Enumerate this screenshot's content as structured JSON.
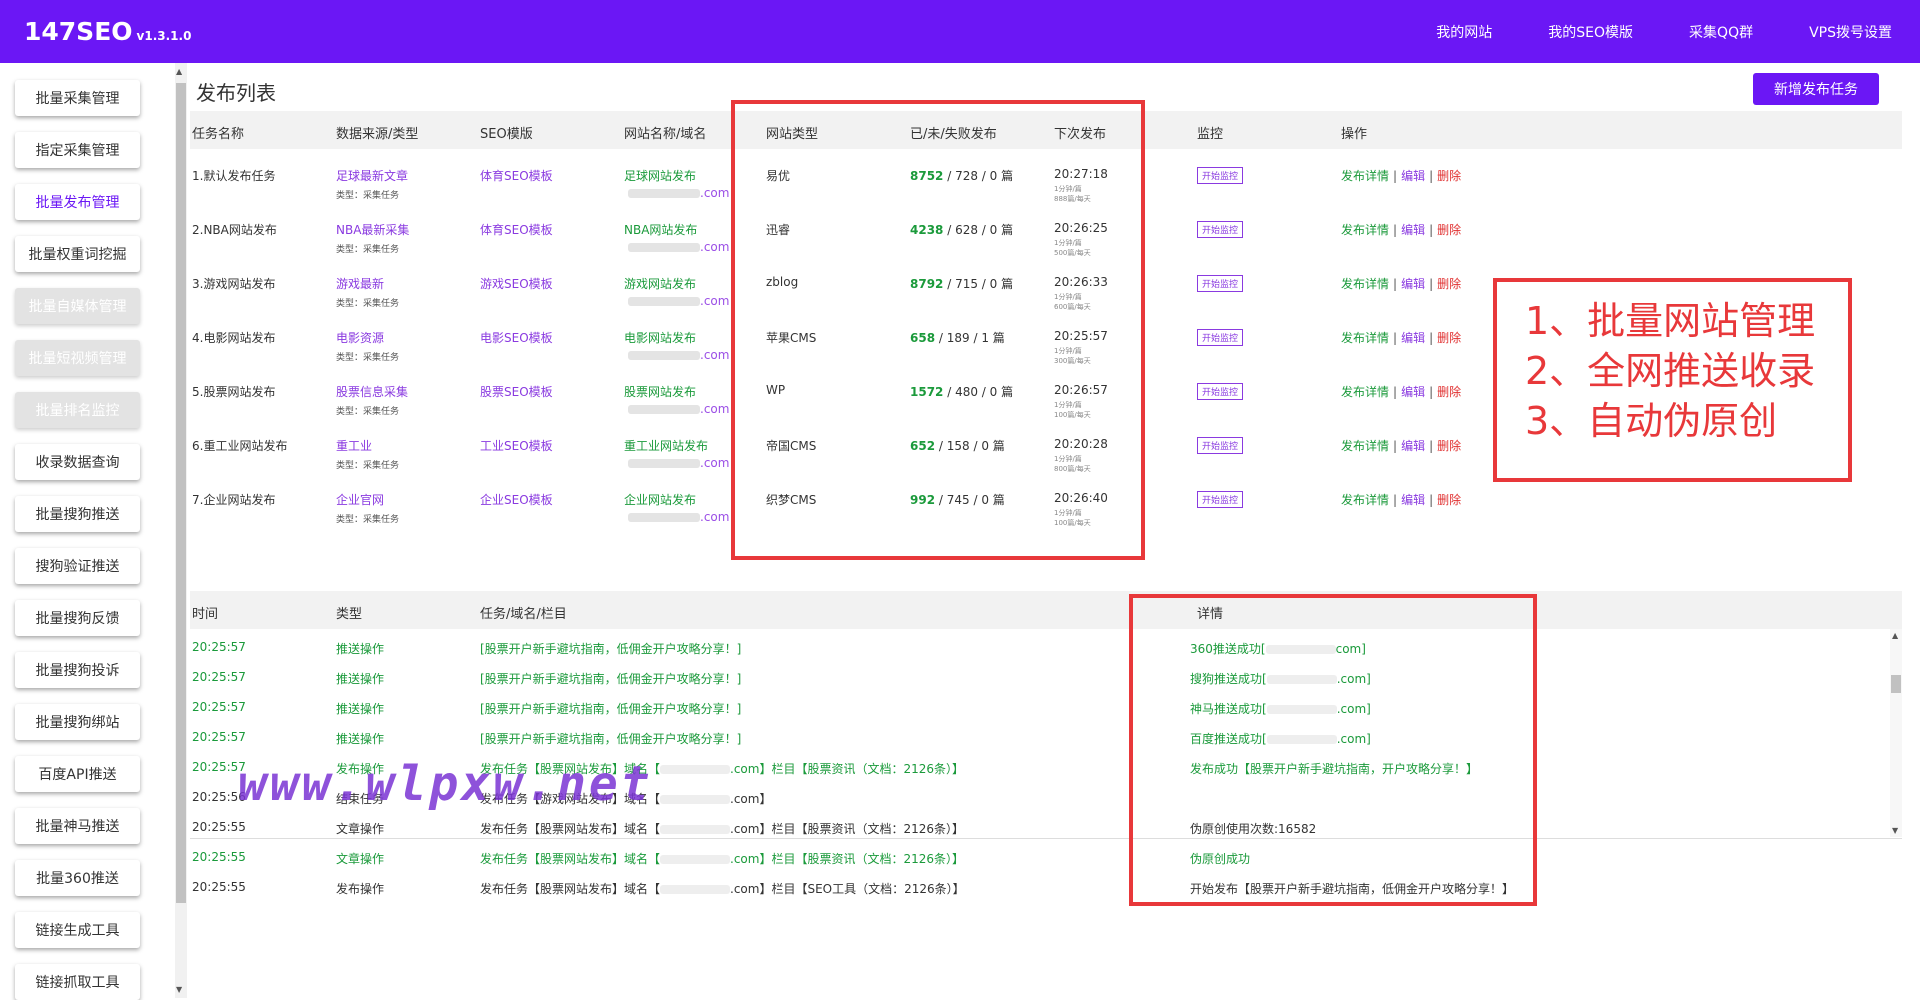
{
  "app": {
    "name": "147SEO",
    "version": "v1.3.1.0"
  },
  "nav": [
    "我的网站",
    "我的SEO模版",
    "采集QQ群",
    "VPS拨号设置"
  ],
  "sidebar": [
    {
      "label": "批量采集管理",
      "state": "normal"
    },
    {
      "label": "指定采集管理",
      "state": "normal"
    },
    {
      "label": "批量发布管理",
      "state": "active"
    },
    {
      "label": "批量权重词挖掘",
      "state": "normal"
    },
    {
      "label": "批量自媒体管理",
      "state": "disabled"
    },
    {
      "label": "批量短视频管理",
      "state": "disabled"
    },
    {
      "label": "批量排名监控",
      "state": "disabled"
    },
    {
      "label": "收录数据查询",
      "state": "normal"
    },
    {
      "label": "批量搜狗推送",
      "state": "normal"
    },
    {
      "label": "搜狗验证推送",
      "state": "normal"
    },
    {
      "label": "批量搜狗反馈",
      "state": "normal"
    },
    {
      "label": "批量搜狗投诉",
      "state": "normal"
    },
    {
      "label": "批量搜狗绑站",
      "state": "normal"
    },
    {
      "label": "百度API推送",
      "state": "normal"
    },
    {
      "label": "批量神马推送",
      "state": "normal"
    },
    {
      "label": "批量360推送",
      "state": "normal"
    },
    {
      "label": "链接生成工具",
      "state": "normal"
    },
    {
      "label": "链接抓取工具",
      "state": "normal"
    }
  ],
  "page": {
    "title": "发布列表",
    "add_button": "新增发布任务"
  },
  "table": {
    "headers": [
      "任务名称",
      "数据来源/类型",
      "SEO模版",
      "网站名称/域名",
      "网站类型",
      "已/未/失败发布",
      "下次发布",
      "监控",
      "操作"
    ],
    "source_type_label": "类型：采集任务",
    "domain_suffix": ".com",
    "monitor_label": "开始监控",
    "ops": {
      "detail": "发布详情",
      "edit": "编辑",
      "delete": "删除",
      "separator": "|"
    },
    "rows": [
      {
        "name": "1.默认发布任务",
        "source": "足球最新文章",
        "template": "体育SEO模板",
        "site": "足球网站发布",
        "site_type": "易优",
        "published": "8752",
        "unpublished": "728",
        "failed": "0 篇",
        "next_time": "20:27:18",
        "interval": "1分钟/篇",
        "daily": "888篇/每天"
      },
      {
        "name": "2.NBA网站发布",
        "source": "NBA最新采集",
        "template": "体育SEO模板",
        "site": "NBA网站发布",
        "site_type": "迅睿",
        "published": "4238",
        "unpublished": "628",
        "failed": "0 篇",
        "next_time": "20:26:25",
        "interval": "1分钟/篇",
        "daily": "500篇/每天"
      },
      {
        "name": "3.游戏网站发布",
        "source": "游戏最新",
        "template": "游戏SEO模板",
        "site": "游戏网站发布",
        "site_type": "zblog",
        "published": "8792",
        "unpublished": "715",
        "failed": "0 篇",
        "next_time": "20:26:33",
        "interval": "1分钟/篇",
        "daily": "600篇/每天"
      },
      {
        "name": "4.电影网站发布",
        "source": "电影资源",
        "template": "电影SEO模板",
        "site": "电影网站发布",
        "site_type": "苹果CMS",
        "published": "658",
        "unpublished": "189",
        "failed": "1 篇",
        "next_time": "20:25:57",
        "interval": "1分钟/篇",
        "daily": "300篇/每天"
      },
      {
        "name": "5.股票网站发布",
        "source": "股票信息采集",
        "template": "股票SEO模板",
        "site": "股票网站发布",
        "site_type": "WP",
        "published": "1572",
        "unpublished": "480",
        "failed": "0 篇",
        "next_time": "20:26:57",
        "interval": "1分钟/篇",
        "daily": "100篇/每天"
      },
      {
        "name": "6.重工业网站发布",
        "source": "重工业",
        "template": "工业SEO模板",
        "site": "重工业网站发布",
        "site_type": "帝国CMS",
        "published": "652",
        "unpublished": "158",
        "failed": "0 篇",
        "next_time": "20:20:28",
        "interval": "1分钟/篇",
        "daily": "800篇/每天"
      },
      {
        "name": "7.企业网站发布",
        "source": "企业官网",
        "template": "企业SEO模板",
        "site": "企业网站发布",
        "site_type": "织梦CMS",
        "published": "992",
        "unpublished": "745",
        "failed": "0 篇",
        "next_time": "20:26:40",
        "interval": "1分钟/篇",
        "daily": "100篇/每天"
      }
    ]
  },
  "log": {
    "headers": [
      "时间",
      "类型",
      "任务/域名/栏目",
      "详情"
    ],
    "rows": [
      {
        "time": "20:25:57",
        "type": "推送操作",
        "task": "[股票开户新手避坑指南，低佣金开户攻略分享！]",
        "detail": "360推送成功[",
        "detail_end": "com]",
        "color": "green"
      },
      {
        "time": "20:25:57",
        "type": "推送操作",
        "task": "[股票开户新手避坑指南，低佣金开户攻略分享！]",
        "detail": "搜狗推送成功[",
        "detail_end": ".com]",
        "color": "green"
      },
      {
        "time": "20:25:57",
        "type": "推送操作",
        "task": "[股票开户新手避坑指南，低佣金开户攻略分享！]",
        "detail": "神马推送成功[",
        "detail_end": ".com]",
        "color": "green"
      },
      {
        "time": "20:25:57",
        "type": "推送操作",
        "task": "[股票开户新手避坑指南，低佣金开户攻略分享！]",
        "detail": "百度推送成功[",
        "detail_end": ".com]",
        "color": "green"
      },
      {
        "time": "20:25:57",
        "type": "发布操作",
        "task": "发布任务【股票网站发布】域名【",
        "task_end": ".com】栏目【股票资讯（文档：2126条）】",
        "detail": "发布成功【股票开户新手避坑指南，开户攻略分享！】",
        "color": "green"
      },
      {
        "time": "20:25:56",
        "type": "结束任务",
        "task": "发布任务【游戏网站发布】域名【",
        "task_end": ".com】",
        "detail": "",
        "color": "black"
      },
      {
        "time": "20:25:55",
        "type": "文章操作",
        "task": "发布任务【股票网站发布】域名【",
        "task_end": ".com】栏目【股票资讯（文档：2126条）】",
        "detail": "伪原创使用次数:16582",
        "color": "black"
      },
      {
        "time": "20:25:55",
        "type": "文章操作",
        "task": "发布任务【股票网站发布】域名【",
        "task_end": ".com】栏目【股票资讯（文档：2126条）】",
        "detail": "伪原创成功",
        "color": "green"
      },
      {
        "time": "20:25:55",
        "type": "发布操作",
        "task": "发布任务【股票网站发布】域名【",
        "task_end": ".com】栏目【SEO工具（文档：2126条）】",
        "detail": "开始发布【股票开户新手避坑指南，低佣金开户攻略分享！】",
        "color": "black"
      }
    ]
  },
  "annotation": {
    "lines": [
      "1、批量网站管理",
      "2、全网推送收录",
      "3、自动伪原创"
    ],
    "color": "#e8383a"
  },
  "watermark": "www.wlpxw.net",
  "colors": {
    "brand": "#6b17f5",
    "success": "#1b9a3b",
    "danger": "#e03030",
    "link": "#8a3ae0"
  }
}
